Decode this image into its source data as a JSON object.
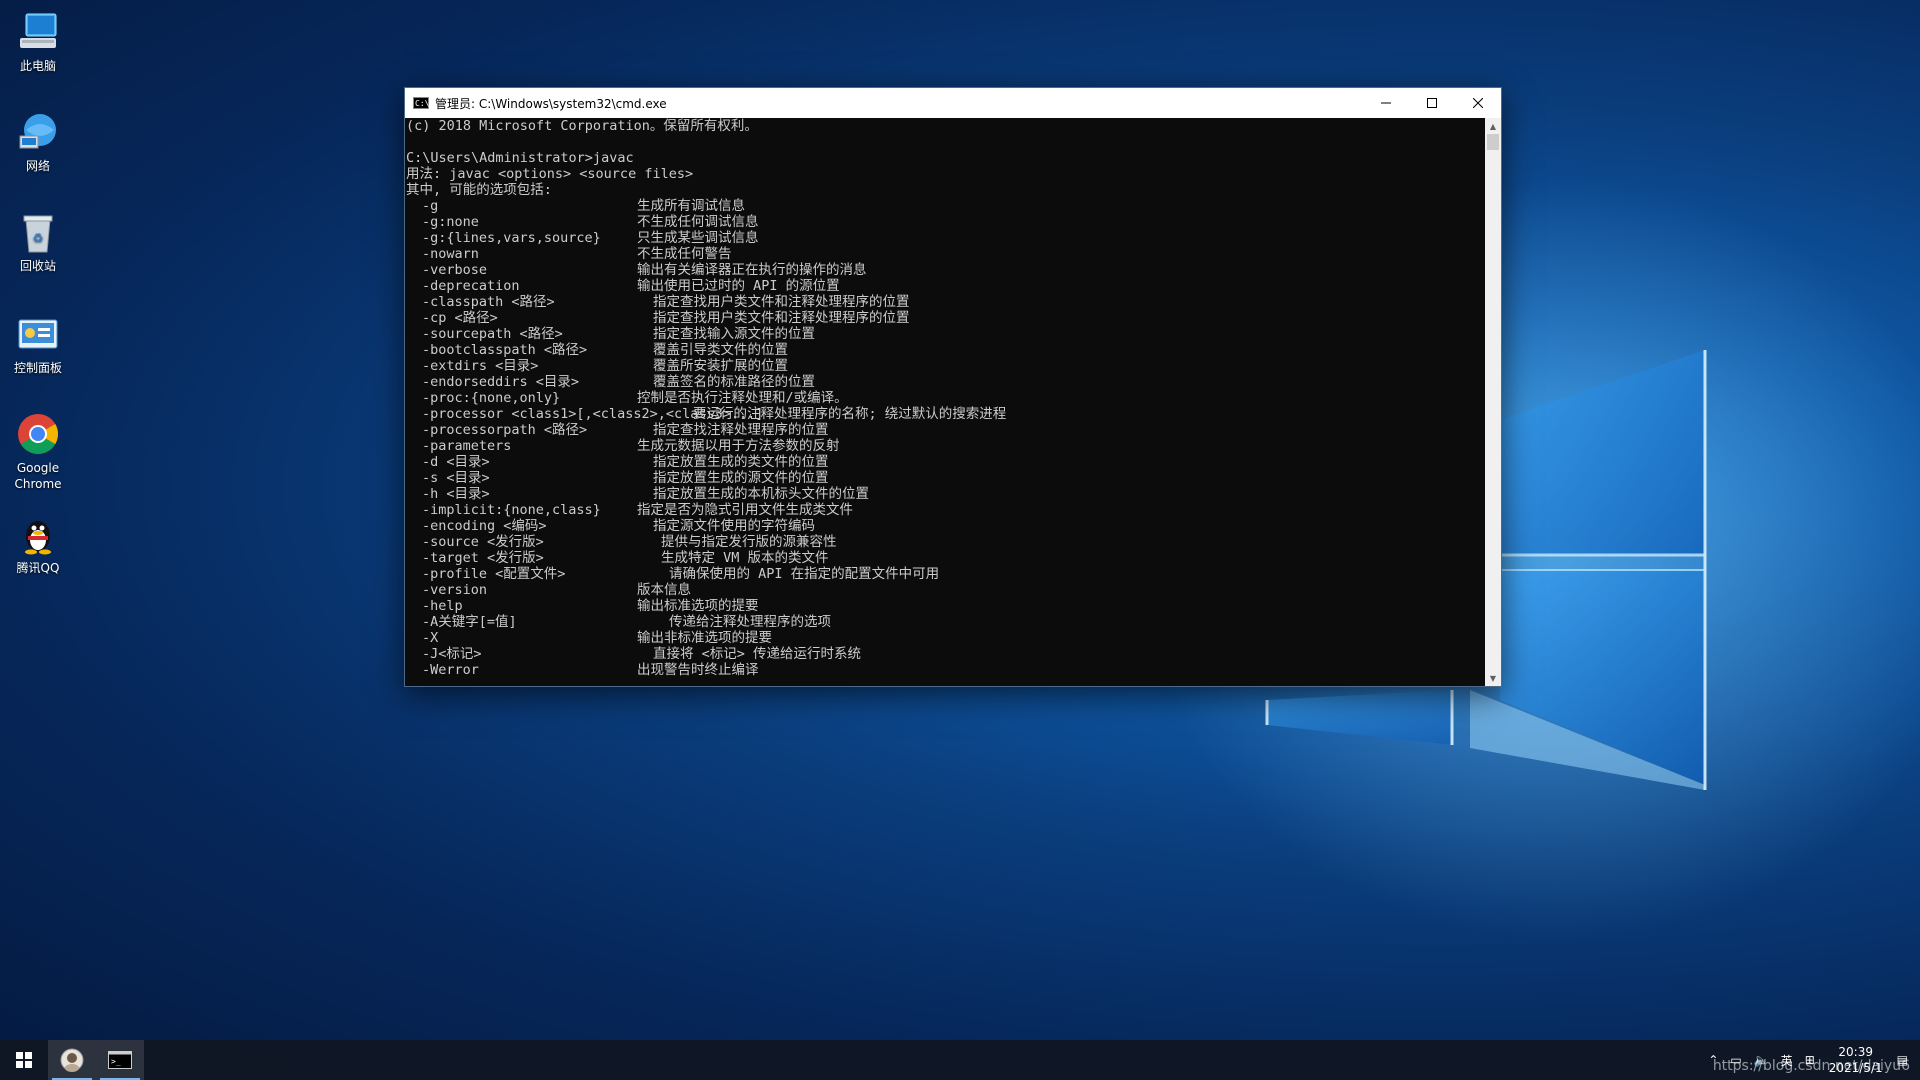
{
  "desktop": {
    "icons": [
      {
        "label": "此电脑",
        "icon": "computer-icon"
      },
      {
        "label": "网络",
        "icon": "network-icon"
      },
      {
        "label": "回收站",
        "icon": "recycle-bin-icon"
      },
      {
        "label": "控制面板",
        "icon": "control-panel-icon"
      },
      {
        "label": "Google\nChrome",
        "icon": "chrome-icon"
      },
      {
        "label": "腾讯QQ",
        "icon": "qq-icon"
      }
    ]
  },
  "window": {
    "title": "管理员: C:\\Windows\\system32\\cmd.exe",
    "minimize_label": "–",
    "maximize_label": "□",
    "close_label": "✕"
  },
  "console": {
    "header_lines": [
      "(c) 2018 Microsoft Corporation。保留所有权利。",
      "",
      "C:\\Users\\Administrator>javac",
      "用法: javac <options> <source files>",
      "其中, 可能的选项包括:"
    ],
    "options": [
      {
        "opt": "-g",
        "desc": "生成所有调试信息",
        "col": 0
      },
      {
        "opt": "-g:none",
        "desc": "不生成任何调试信息",
        "col": 0
      },
      {
        "opt": "-g:{lines,vars,source}",
        "desc": "只生成某些调试信息",
        "col": 0
      },
      {
        "opt": "-nowarn",
        "desc": "不生成任何警告",
        "col": 0
      },
      {
        "opt": "-verbose",
        "desc": "输出有关编译器正在执行的操作的消息",
        "col": 0
      },
      {
        "opt": "-deprecation",
        "desc": "输出使用已过时的 API 的源位置",
        "col": 0
      },
      {
        "opt": "-classpath <路径>",
        "desc": "指定查找用户类文件和注释处理程序的位置",
        "col": 1
      },
      {
        "opt": "-cp <路径>",
        "desc": "指定查找用户类文件和注释处理程序的位置",
        "col": 1
      },
      {
        "opt": "-sourcepath <路径>",
        "desc": "指定查找输入源文件的位置",
        "col": 1
      },
      {
        "opt": "-bootclasspath <路径>",
        "desc": "覆盖引导类文件的位置",
        "col": 1
      },
      {
        "opt": "-extdirs <目录>",
        "desc": "覆盖所安装扩展的位置",
        "col": 1
      },
      {
        "opt": "-endorseddirs <目录>",
        "desc": "覆盖签名的标准路径的位置",
        "col": 1
      },
      {
        "opt": "-proc:{none,only}",
        "desc": "控制是否执行注释处理和/或编译。",
        "col": 0
      },
      {
        "opt": "-processor <class1>[,<class2>,<class3>...]",
        "desc": "要运行的注释处理程序的名称; 绕过默认的搜索进程",
        "col": 2
      },
      {
        "opt": "-processorpath <路径>",
        "desc": "指定查找注释处理程序的位置",
        "col": 1
      },
      {
        "opt": "-parameters",
        "desc": "生成元数据以用于方法参数的反射",
        "col": 0
      },
      {
        "opt": "-d <目录>",
        "desc": "指定放置生成的类文件的位置",
        "col": 1
      },
      {
        "opt": "-s <目录>",
        "desc": "指定放置生成的源文件的位置",
        "col": 1
      },
      {
        "opt": "-h <目录>",
        "desc": "指定放置生成的本机标头文件的位置",
        "col": 1
      },
      {
        "opt": "-implicit:{none,class}",
        "desc": "指定是否为隐式引用文件生成类文件",
        "col": 0
      },
      {
        "opt": "-encoding <编码>",
        "desc": "指定源文件使用的字符编码",
        "col": 1
      },
      {
        "opt": "-source <发行版>",
        "desc": "提供与指定发行版的源兼容性",
        "col": 3
      },
      {
        "opt": "-target <发行版>",
        "desc": "生成特定 VM 版本的类文件",
        "col": 3
      },
      {
        "opt": "-profile <配置文件>",
        "desc": "请确保使用的 API 在指定的配置文件中可用",
        "col": 4
      },
      {
        "opt": "-version",
        "desc": "版本信息",
        "col": 0
      },
      {
        "opt": "-help",
        "desc": "输出标准选项的提要",
        "col": 0
      },
      {
        "opt": "-A关键字[=值]",
        "desc": "传递给注释处理程序的选项",
        "col": 4
      },
      {
        "opt": "-X",
        "desc": "输出非标准选项的提要",
        "col": 0
      },
      {
        "opt": "-J<标记>",
        "desc": "直接将 <标记> 传递给运行时系统",
        "col": 1
      },
      {
        "opt": "-Werror",
        "desc": "出现警告时终止编译",
        "col": 0
      }
    ]
  },
  "taskbar": {
    "items": [
      {
        "name": "start-button",
        "icon": "windows-icon"
      },
      {
        "name": "taskbar-avatar-app",
        "icon": "avatar-icon"
      },
      {
        "name": "taskbar-cmd-app",
        "icon": "cmd-icon"
      }
    ],
    "tray": {
      "ime": "英",
      "time": "20:39",
      "date": "2021/5/1"
    },
    "watermark": "https://blog.csdn.net/daiyu6"
  },
  "colors": {
    "console_bg": "#0c0c0c",
    "console_fg": "#cccccc",
    "accent": "#76b9ed"
  }
}
